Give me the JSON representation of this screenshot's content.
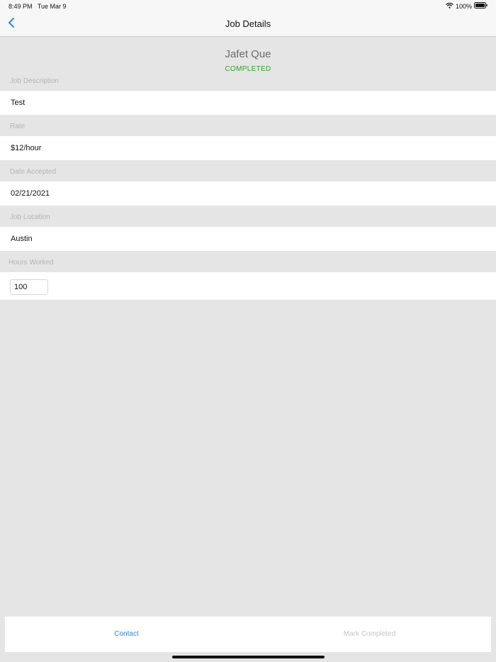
{
  "status_bar": {
    "time": "8:49 PM",
    "date": "Tue Mar 9",
    "battery": "100%"
  },
  "nav": {
    "title": "Job Details",
    "back_icon": "chevron-left-icon"
  },
  "header": {
    "name": "Jafet Que",
    "status": "COMPLETED",
    "status_color": "#2aa52a"
  },
  "fields": {
    "job_description": {
      "label": "Job Description",
      "value": "Test"
    },
    "rate": {
      "label": "Rate",
      "value": "$12/hour"
    },
    "date_accepted": {
      "label": "Date Accepted",
      "value": "02/21/2021"
    },
    "job_location": {
      "label": "Job Location",
      "value": "Austin"
    },
    "hours_worked": {
      "label": "Hours Worked",
      "value": "100"
    }
  },
  "bottom": {
    "contact_label": "Contact",
    "mark_completed_label": "Mark Completed"
  },
  "colors": {
    "accent": "#2f86d6",
    "background": "#e5e5e5"
  }
}
